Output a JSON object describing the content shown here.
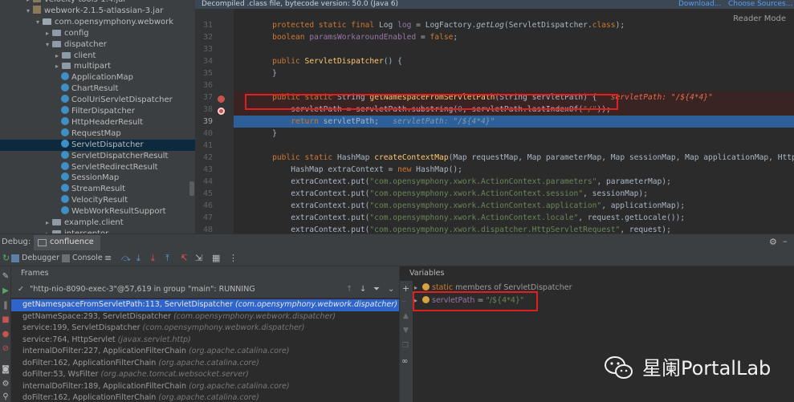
{
  "project_tree": {
    "items": [
      {
        "label": "velocity-tools-1.4.jar",
        "kind": "jar",
        "depth": 3,
        "arrow": "right"
      },
      {
        "label": "webwork-2.1.5-atlassian-3.jar",
        "kind": "jar",
        "depth": 3,
        "arrow": "down"
      },
      {
        "label": "com.opensymphony.webwork",
        "kind": "package",
        "depth": 4,
        "arrow": "down"
      },
      {
        "label": "config",
        "kind": "folder",
        "depth": 5,
        "arrow": "right"
      },
      {
        "label": "dispatcher",
        "kind": "folder",
        "depth": 5,
        "arrow": "down"
      },
      {
        "label": "client",
        "kind": "folder",
        "depth": 6,
        "arrow": "right"
      },
      {
        "label": "multipart",
        "kind": "folder",
        "depth": 6,
        "arrow": "right"
      },
      {
        "label": "ApplicationMap",
        "kind": "class",
        "depth": 6,
        "arrow": ""
      },
      {
        "label": "ChartResult",
        "kind": "class",
        "depth": 6,
        "arrow": ""
      },
      {
        "label": "CoolUriServletDispatcher",
        "kind": "class",
        "depth": 6,
        "arrow": ""
      },
      {
        "label": "FilterDispatcher",
        "kind": "class",
        "depth": 6,
        "arrow": ""
      },
      {
        "label": "HttpHeaderResult",
        "kind": "class",
        "depth": 6,
        "arrow": ""
      },
      {
        "label": "RequestMap",
        "kind": "class",
        "depth": 6,
        "arrow": ""
      },
      {
        "label": "ServletDispatcher",
        "kind": "class",
        "depth": 6,
        "arrow": "",
        "selected": true
      },
      {
        "label": "ServletDispatcherResult",
        "kind": "class",
        "depth": 6,
        "arrow": ""
      },
      {
        "label": "ServletRedirectResult",
        "kind": "class",
        "depth": 6,
        "arrow": ""
      },
      {
        "label": "SessionMap",
        "kind": "class",
        "depth": 6,
        "arrow": ""
      },
      {
        "label": "StreamResult",
        "kind": "class",
        "depth": 6,
        "arrow": ""
      },
      {
        "label": "VelocityResult",
        "kind": "class",
        "depth": 6,
        "arrow": ""
      },
      {
        "label": "WebWorkResultSupport",
        "kind": "class",
        "depth": 6,
        "arrow": ""
      },
      {
        "label": "example.client",
        "kind": "folder",
        "depth": 5,
        "arrow": "right"
      },
      {
        "label": "interceptor",
        "kind": "folder",
        "depth": 5,
        "arrow": "right"
      }
    ]
  },
  "editor": {
    "banner": "Decompiled .class file, bytecode version: 50.0 (Java 6)",
    "download_link": "Download...",
    "choose_sources_link": "Choose Sources...",
    "reader_mode": "Reader Mode",
    "lines": [
      {
        "no": "31",
        "html": "    <span class=\"kw\">protected static final</span> Log <span class=\"fld\">log</span> = LogFactory.<i>getLog</i>(ServletDispatcher.<span class=\"kw\">class</span>);"
      },
      {
        "no": "32",
        "html": "    <span class=\"kw\">boolean</span> <span class=\"fld\">paramsWorkaroundEnabled</span> = <span class=\"kw\">false</span>;"
      },
      {
        "no": "33",
        "html": ""
      },
      {
        "no": "34",
        "html": "    <span class=\"kw\">public</span> <span class=\"fn\">ServletDispatcher</span>() {"
      },
      {
        "no": "35",
        "html": "    }"
      },
      {
        "no": "36",
        "html": ""
      },
      {
        "no": "37",
        "html": "    <span class=\"kw\">public static</span> String <span class=\"fn\">getNamespaceFromServletPath</span>(String servletPath) {   <span class=\"inl-r\">servletPath: \"/${4*4}\"</span>",
        "style": "bp"
      },
      {
        "no": "38",
        "html": "        servletPath = servletPath.substring(<span class=\"num\">0</span>, servletPath.lastIndexOf(<span class=\"str\">\"/\"</span>));",
        "style": "bp"
      },
      {
        "no": "39",
        "html": "        <span class=\"kw\">return</span> servletPath;   <span class=\"inl\">servletPath: \"/${4*4}\"</span>",
        "style": "exec"
      },
      {
        "no": "40",
        "html": "    }"
      },
      {
        "no": "41",
        "html": ""
      },
      {
        "no": "42",
        "html": "    <span class=\"kw\">public static</span> HashMap <span class=\"fn\">createContextMap</span>(Map requestMap, Map parameterMap, Map sessionMap, Map applicationMap, HttpServletRe"
      },
      {
        "no": "43",
        "html": "        HashMap extraContext = <span class=\"kw\">new</span> HashMap();"
      },
      {
        "no": "44",
        "html": "        extraContext.put(<span class=\"str\">\"com.opensymphony.xwork.ActionContext.parameters\"</span>, parameterMap);"
      },
      {
        "no": "45",
        "html": "        extraContext.put(<span class=\"str\">\"com.opensymphony.xwork.ActionContext.session\"</span>, sessionMap);"
      },
      {
        "no": "46",
        "html": "        extraContext.put(<span class=\"str\">\"com.opensymphony.xwork.ActionContext.application\"</span>, applicationMap);"
      },
      {
        "no": "47",
        "html": "        extraContext.put(<span class=\"str\">\"com.opensymphony.xwork.ActionContext.locale\"</span>, request.getLocale());"
      },
      {
        "no": "48",
        "html": "        extraContext.put(<span class=\"str\">\"com.opensymphony.xwork.dispatcher.HttpServletRequest\"</span>, request);"
      }
    ]
  },
  "debug": {
    "label": "Debug:",
    "config_tab": "confluence",
    "debugger_tab": "Debugger",
    "console_tab": "Console",
    "frames_title": "Frames",
    "thread_text": "\"http-nio-8090-exec-3\"@57,619 in group \"main\": RUNNING",
    "frames": [
      {
        "method": "getNamespaceFromServletPath:113, ServletDispatcher",
        "pkg": "(com.opensymphony.webwork.dispatcher)",
        "selected": true
      },
      {
        "method": "getNameSpace:293, ServletDispatcher",
        "pkg": "(com.opensymphony.webwork.dispatcher)"
      },
      {
        "method": "service:199, ServletDispatcher",
        "pkg": "(com.opensymphony.webwork.dispatcher)"
      },
      {
        "method": "service:764, HttpServlet",
        "pkg": "(javax.servlet.http)"
      },
      {
        "method": "internalDoFilter:227, ApplicationFilterChain",
        "pkg": "(org.apache.catalina.core)"
      },
      {
        "method": "doFilter:162, ApplicationFilterChain",
        "pkg": "(org.apache.catalina.core)"
      },
      {
        "method": "doFilter:53, WsFilter",
        "pkg": "(org.apache.tomcat.websocket.server)"
      },
      {
        "method": "internalDoFilter:189, ApplicationFilterChain",
        "pkg": "(org.apache.catalina.core)"
      },
      {
        "method": "doFilter:162, ApplicationFilterChain",
        "pkg": "(org.apache.catalina.core)"
      }
    ],
    "variables_title": "Variables",
    "variables": [
      {
        "html": "<span style=\"color:#cc7832\">static</span> <span style=\"color:#9a9a9a\">members of ServletDispatcher</span>"
      },
      {
        "html": "<span style=\"color:#9876aa\">servletPath</span> <span style=\"color:#bbbbbb\">=</span> <span style=\"color:#6a8759\">\"/${4*4}\"</span>"
      }
    ]
  },
  "watermark": {
    "text": "星阑PortalLab"
  },
  "colors": {
    "highlight_box": "#e02020",
    "selection_blue": "#2f65ca",
    "exec_line": "#2d6099",
    "breakpoint": "#c75450"
  }
}
